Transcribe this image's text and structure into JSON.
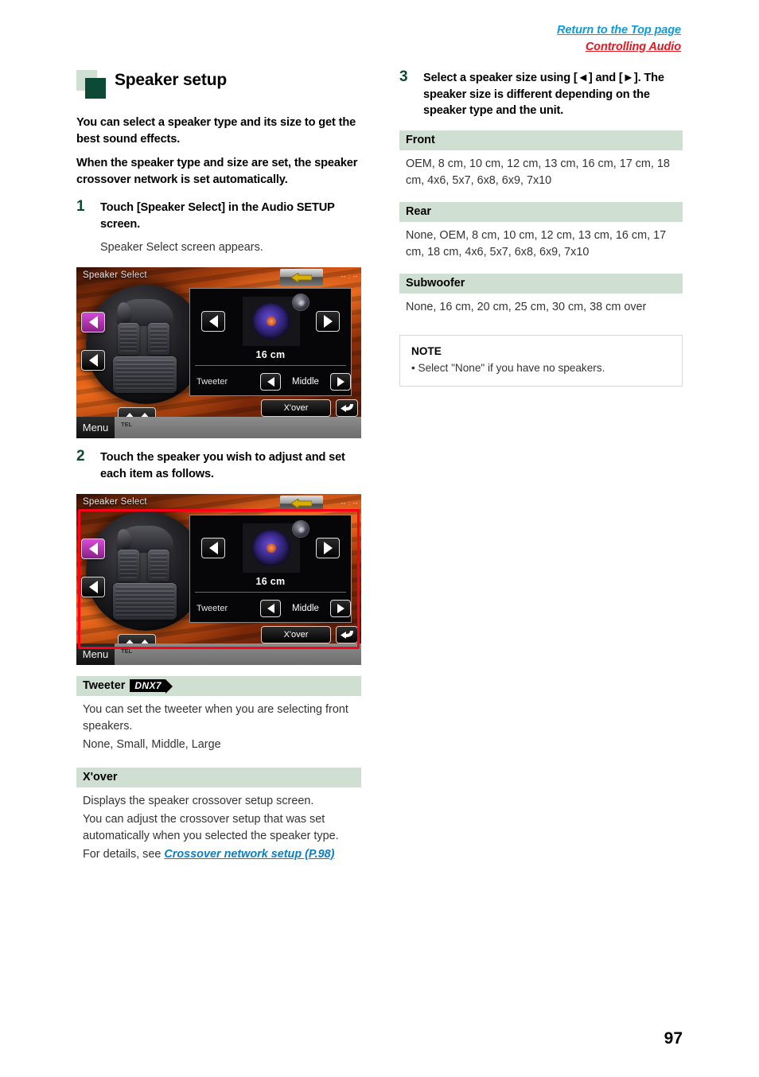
{
  "nav": {
    "top_page_link": "Return to the Top page",
    "chapter_link": "Controlling Audio",
    "top_page_color": "#0b9cd9",
    "chapter_color": "#e8171f"
  },
  "section": {
    "title": "Speaker setup",
    "intro_1": "You can select a speaker type and its size to get the best sound effects.",
    "intro_2": "When the speaker type and size are set, the speaker crossover network is set automatically."
  },
  "steps": [
    {
      "number": "1",
      "text": "Touch [Speaker Select] in the Audio SETUP screen.",
      "sub": "Speaker Select screen appears."
    },
    {
      "number": "2",
      "text": "Touch the speaker you wish to adjust and set each item as follows."
    },
    {
      "number": "3",
      "text": "Select a speaker size using [◄] and [►]. The speaker size is different depending on the speaker type and the unit."
    }
  ],
  "device_screen": {
    "title": "Speaker Select",
    "clock": "-- : --",
    "size_value": "16 cm",
    "tweeter_label": "Tweeter",
    "tweeter_value": "Middle",
    "xover_button": "X'over",
    "menu_button": "Menu",
    "tel_label": "TEL"
  },
  "left_sections": [
    {
      "heading": "Tweeter",
      "badge": "DNX7",
      "lines": [
        "You can set the tweeter when you are selecting front speakers.",
        "None, Small, Middle, Large"
      ]
    },
    {
      "heading": "X'over",
      "lines": [
        "Displays the speaker crossover setup screen.",
        "You can adjust the crossover setup that was set automatically when you selected the speaker type."
      ],
      "ref_prefix": "For details, see ",
      "ref_link": "Crossover network setup (P.98)"
    }
  ],
  "right_sections": [
    {
      "heading": "Front",
      "values": "OEM, 8 cm, 10 cm, 12 cm, 13 cm, 16 cm, 17 cm, 18 cm, 4x6, 5x7, 6x8, 6x9, 7x10"
    },
    {
      "heading": "Rear",
      "values": "None, OEM, 8 cm, 10 cm, 12 cm, 13 cm, 16 cm, 17 cm, 18 cm, 4x6, 5x7, 6x8, 6x9, 7x10"
    },
    {
      "heading": "Subwoofer",
      "values": "None, 16 cm, 20 cm, 25 cm, 30 cm, 38 cm over"
    }
  ],
  "note": {
    "title": "NOTE",
    "item": "• Select \"None\" if you have no speakers."
  },
  "page_number": "97",
  "colors": {
    "band_green": "#cfdfd2",
    "dark_green": "#0c4a35",
    "highlight_red": "#ff0019",
    "link_blue": "#0b7fc4"
  }
}
